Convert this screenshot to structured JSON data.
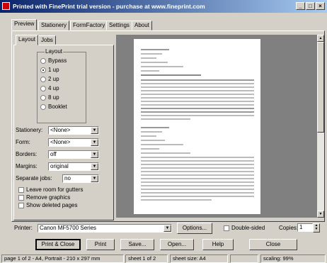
{
  "window": {
    "title": "Printed with FinePrint trial version - purchase at www.fineprint.com",
    "min": "_",
    "max": "□",
    "close": "×"
  },
  "tabs": [
    "Preview",
    "Stationery",
    "FormFactory",
    "Settings",
    "About"
  ],
  "subtabs": [
    "Layout",
    "Jobs"
  ],
  "layout": {
    "group_label": "Layout",
    "options": [
      "Bypass",
      "1 up",
      "2 up",
      "4 up",
      "8 up",
      "Booklet"
    ],
    "selected": "1 up"
  },
  "fields": [
    {
      "label": "Stationery:",
      "value": "<None>"
    },
    {
      "label": "Form:",
      "value": "<None>"
    },
    {
      "label": "Borders:",
      "value": "off"
    },
    {
      "label": "Margins:",
      "value": "original"
    },
    {
      "label": "Separate jobs:",
      "value": "no"
    }
  ],
  "checkboxes": [
    {
      "label": "Leave room for gutters",
      "checked": false
    },
    {
      "label": "Remove graphics",
      "checked": false
    },
    {
      "label": "Show deleted pages",
      "checked": false
    }
  ],
  "printer": {
    "label": "Printer:",
    "value": "Canon MF5700 Series",
    "options_label": "Options...",
    "double_sided_label": "Double-sided",
    "copies_label": "Copies:",
    "copies_value": "1"
  },
  "buttons": {
    "print_close": "Print & Close",
    "print": "Print",
    "save": "Save...",
    "open": "Open...",
    "help": "Help",
    "close": "Close"
  },
  "status": {
    "page": "page 1 of 2 - A4, Portrait - 210 x 297 mm",
    "sheet": "sheet 1 of 2",
    "size": "sheet size: A4",
    "scaling": "scaling: 99%"
  }
}
